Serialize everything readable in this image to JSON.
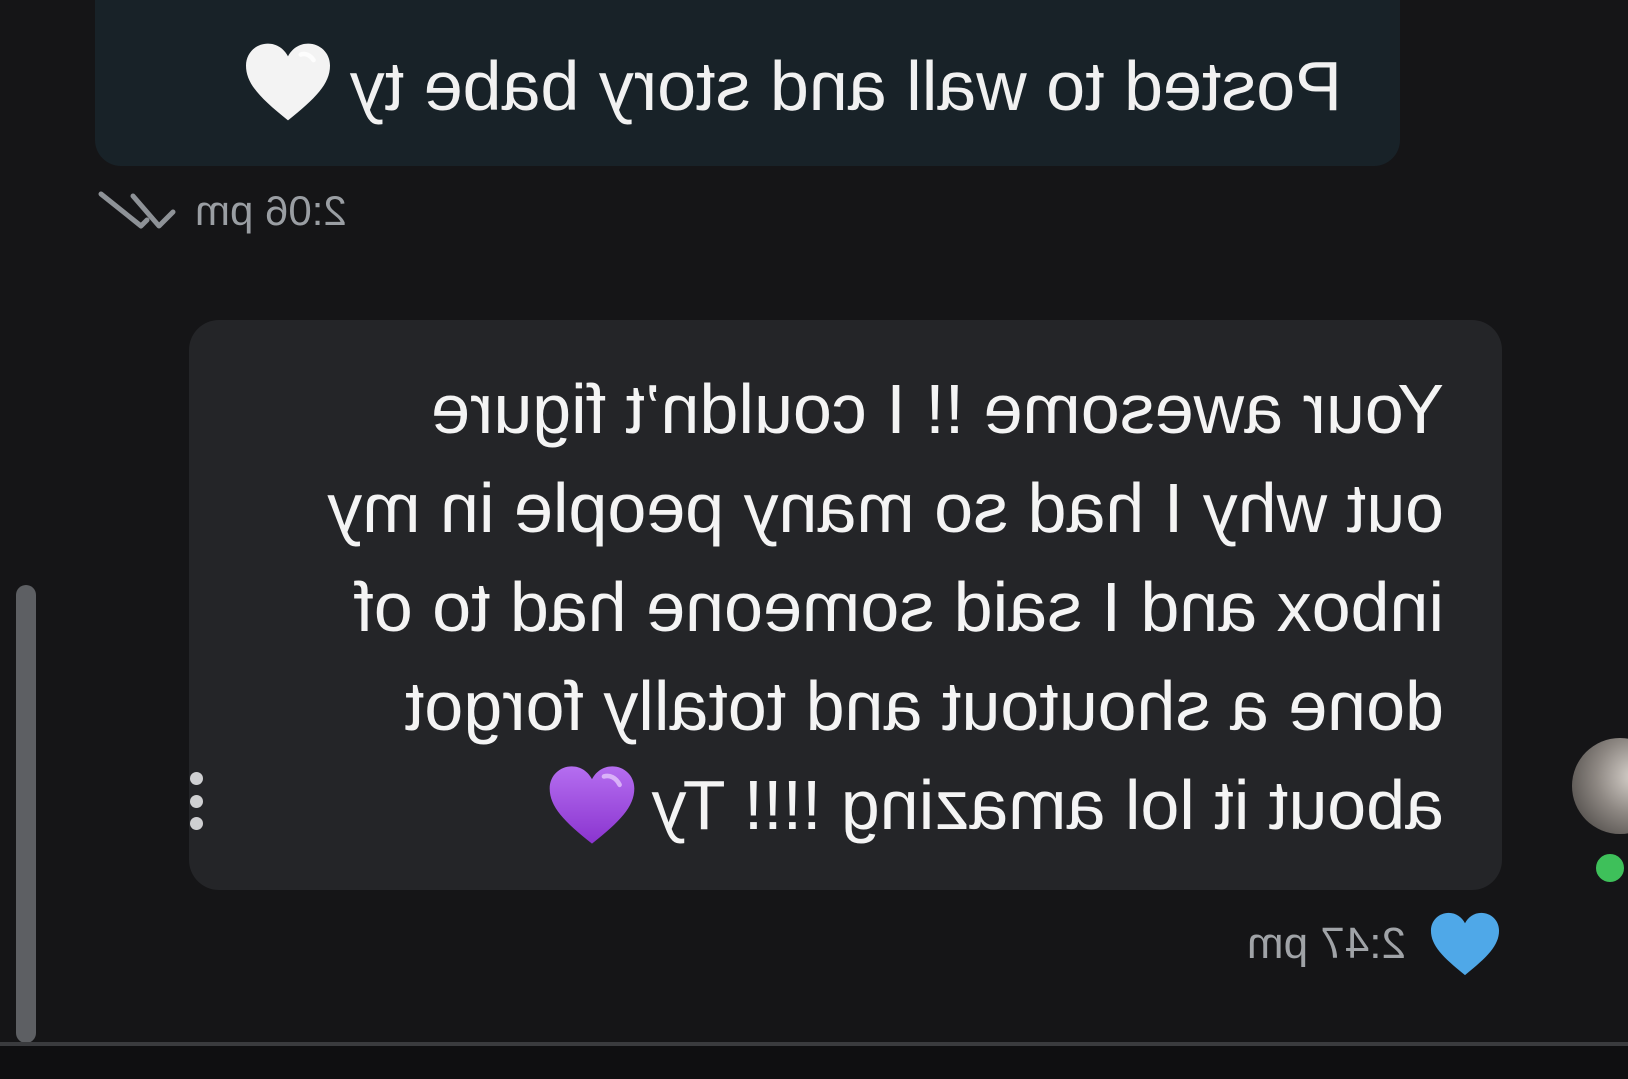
{
  "messages": [
    {
      "direction": "outgoing",
      "text": "Posted to wall and story babe ty",
      "emoji": "white-heart",
      "time": "2:06 pm",
      "status_icon": "read-double-check-icon"
    },
    {
      "direction": "incoming",
      "lines": [
        "Your awesome !! I couldn’t figure",
        "out why I had so many people in my",
        "inbox and I said someone had to of",
        "done a shoutout and totally forgot",
        "about it lol amazing !!!! Ty"
      ],
      "emoji": "purple-heart",
      "time": "2:47 pm",
      "reaction": "blue-heart"
    }
  ],
  "colors": {
    "background": "#151517",
    "outgoing_bubble": "#182228",
    "incoming_bubble": "#242528",
    "online": "#3ec05a",
    "purple_heart": "#a04fe0",
    "blue_heart": "#4fa8e8"
  },
  "display": {
    "mirrored": true
  }
}
